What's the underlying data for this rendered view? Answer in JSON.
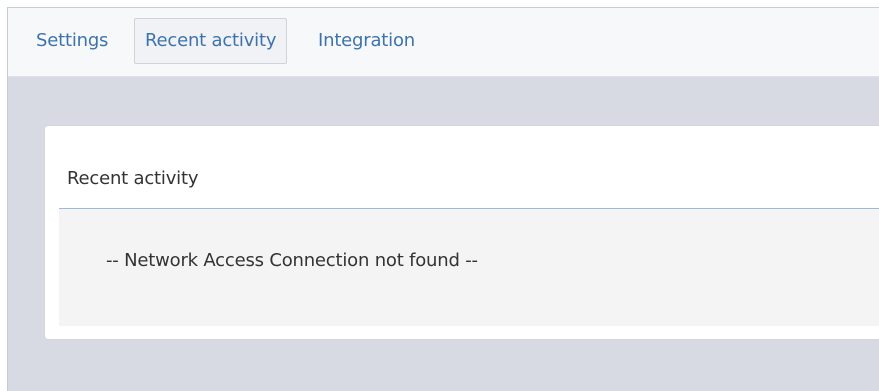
{
  "tabs": [
    {
      "label": "Settings",
      "active": false
    },
    {
      "label": "Recent activity",
      "active": true
    },
    {
      "label": "Integration",
      "active": false
    }
  ],
  "panel": {
    "title": "Recent activity",
    "empty_message": "-- Network Access Connection not found --"
  },
  "colors": {
    "tab_link": "#3d73ad",
    "frame_background": "#d7dae3",
    "panel_body_background": "#f4f4f4",
    "divider": "#9fb8d6"
  }
}
